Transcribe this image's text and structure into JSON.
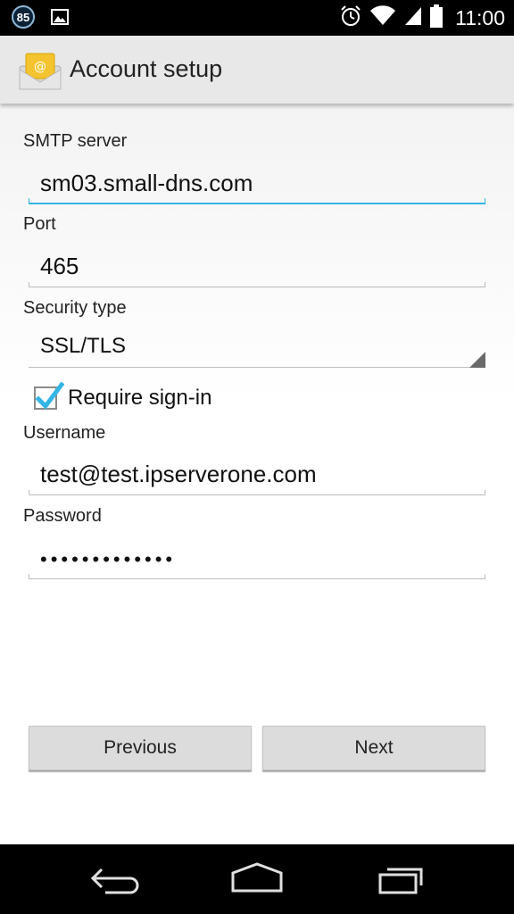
{
  "status_bar": {
    "notification_count": "85",
    "time": "11:00"
  },
  "action_bar": {
    "title": "Account setup"
  },
  "form": {
    "smtp_label": "SMTP server",
    "smtp_value": "sm03.small-dns.com",
    "port_label": "Port",
    "port_value": "465",
    "security_label": "Security type",
    "security_value": "SSL/TLS",
    "require_signin_label": "Require sign-in",
    "require_signin_checked": true,
    "username_label": "Username",
    "username_value": "test@test.ipserverone.com",
    "password_label": "Password",
    "password_value": "•••••••••••••"
  },
  "buttons": {
    "previous": "Previous",
    "next": "Next"
  },
  "colors": {
    "accent": "#33b5e5"
  }
}
